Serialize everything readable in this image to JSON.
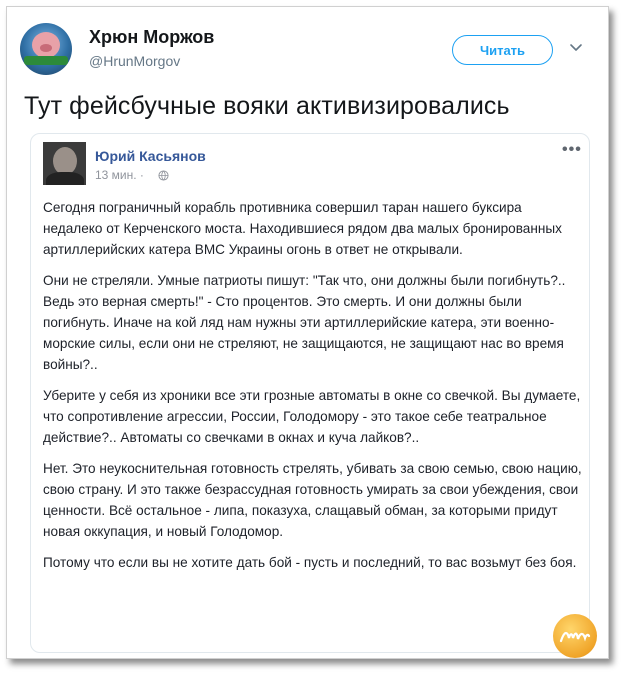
{
  "tweet": {
    "author_name": "Хрюн Моржов",
    "author_handle": "@HrunMorgov",
    "follow_label": "Читать",
    "text": "Тут фейсбучные вояки активизировались"
  },
  "embedded_post": {
    "author_name": "Юрий Касьянов",
    "time": "13 мин. ·",
    "more_label": "•••",
    "paragraphs": [
      "Сегодня пограничный корабль противника совершил таран нашего буксира недалеко от Керченского моста. Находившиеся рядом два малых бронированных артиллерийских катера ВМС Украины огонь в ответ не открывали.",
      "Они не стреляли. Умные патриоты пишут: \"Так что, они должны были погибнуть?.. Ведь это верная смерть!\" - Сто процентов. Это смерть. И они должны были погибнуть. Иначе на кой ляд нам нужны эти артиллерийские катера, эти военно-морские силы, если они не стреляют, не защищаются, не защищают нас во время войны?..",
      "Уберите у себя из хроники все эти грозные автоматы в окне со свечкой. Вы думаете, что сопротивление агрессии, России, Голодомору - это такое себе театральное действие?.. Автоматы со свечками в окнах и куча лайков?..",
      "Нет. Это неукоснительная готовность стрелять, убивать за свою семью, свою нацию, свою страну. И это также безрассудная готовность умирать за свои убеждения, свои ценности. Всё остальное - липа, показуха, слащавый обман, за которыми придут новая оккупация, и новый Голодомор.",
      "Потому что если вы не хотите дать бой - пусть и последний, то вас возьмут без боя."
    ]
  },
  "icons": [
    "avatar-pig",
    "chevron-down-icon",
    "globe-icon",
    "more-icon",
    "watermark-logo"
  ],
  "colors": {
    "twitter_blue": "#1da1f2",
    "fb_name_blue": "#365899",
    "text_dark": "#14171a",
    "muted": "#657786"
  }
}
